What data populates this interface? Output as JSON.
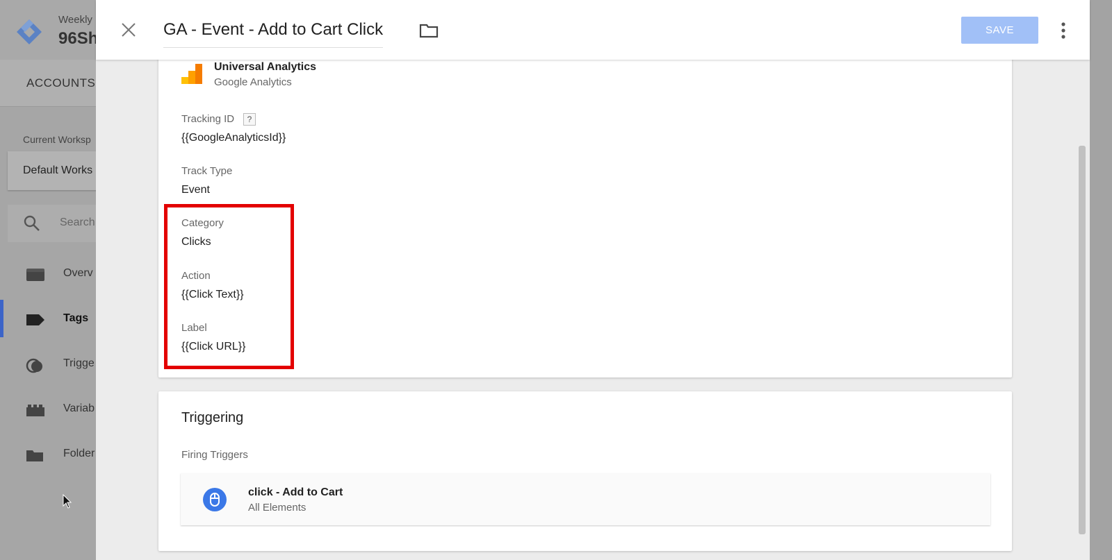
{
  "background": {
    "header": {
      "subtitle": "Weekly",
      "container_name": "96Sh"
    },
    "accounts_tab": "ACCOUNTS",
    "workspace": {
      "label": "Current Worksp",
      "value": "Default Works"
    },
    "search": {
      "placeholder": "Search"
    },
    "nav": [
      {
        "label": "Overv",
        "icon": "overview-icon"
      },
      {
        "label": "Tags",
        "icon": "tag-icon",
        "active": true
      },
      {
        "label": "Trigge",
        "icon": "trigger-icon"
      },
      {
        "label": "Variab",
        "icon": "variable-icon"
      },
      {
        "label": "Folder",
        "icon": "folder-icon"
      }
    ]
  },
  "panel": {
    "title": "GA - Event - Add to Cart Click",
    "save_label": "SAVE",
    "colors": {
      "save_button": "#a1c0f7",
      "highlight_box": "#e30000",
      "trigger_icon": "#3b78e7"
    }
  },
  "tag_config": {
    "tag_type": {
      "title": "Universal Analytics",
      "subtitle": "Google Analytics",
      "icon": "universal-analytics-icon"
    },
    "fields": {
      "tracking_id": {
        "label": "Tracking ID",
        "value": "{{GoogleAnalyticsId}}",
        "help": "?"
      },
      "track_type": {
        "label": "Track Type",
        "value": "Event"
      },
      "category": {
        "label": "Category",
        "value": "Clicks"
      },
      "action": {
        "label": "Action",
        "value": "{{Click Text}}"
      },
      "label": {
        "label": "Label",
        "value": "{{Click URL}}"
      }
    }
  },
  "triggering": {
    "title": "Triggering",
    "subtitle": "Firing Triggers",
    "triggers": [
      {
        "name": "click - Add to Cart",
        "type": "All Elements",
        "icon": "click-trigger-icon"
      }
    ]
  }
}
